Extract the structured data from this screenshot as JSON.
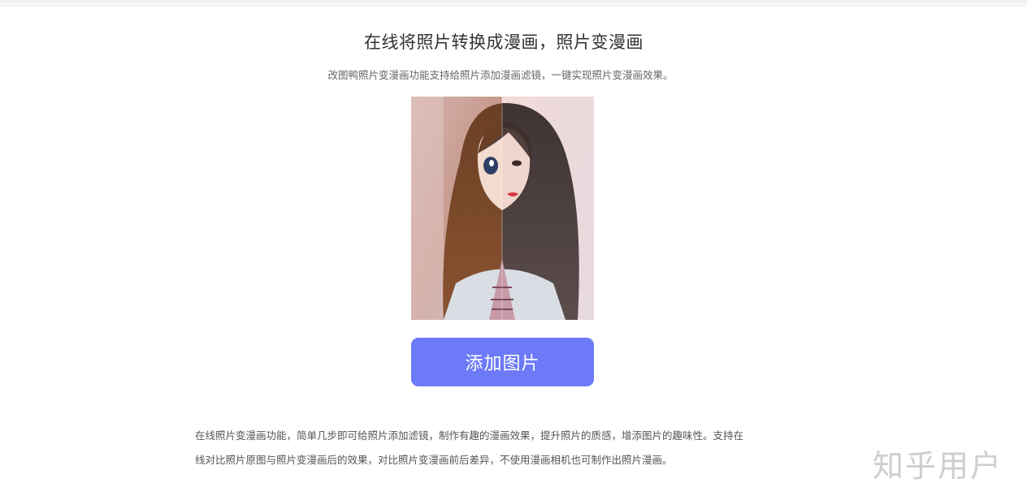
{
  "header": {
    "title": "在线将照片转换成漫画，照片变漫画",
    "subtitle": "改图鸭照片变漫画功能支持给照片添加漫画滤镜，一键实现照片变漫画效果。"
  },
  "upload": {
    "button_label": "添加图片"
  },
  "description": {
    "line1": "在线照片变漫画功能，简单几步即可给照片添加滤镜，制作有趣的漫画效果，提升照片的质感，增添图片的趣味性。支持在",
    "line2": "线对比照片原图与照片变漫画后的效果，对比照片变漫画前后差异，不使用漫画相机也可制作出照片漫画。"
  },
  "watermark": {
    "text": "知乎用户"
  },
  "colors": {
    "accent": "#6c7af8",
    "title": "#333333",
    "subtitle": "#666666"
  }
}
